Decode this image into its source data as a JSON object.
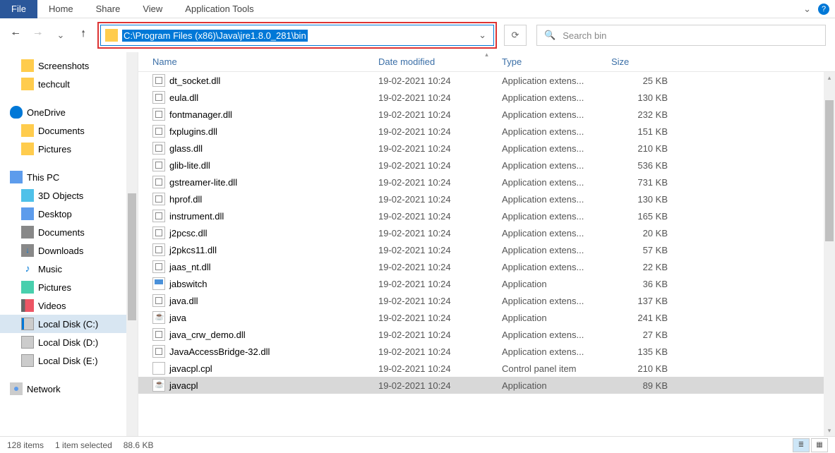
{
  "ribbon": {
    "file": "File",
    "home": "Home",
    "share": "Share",
    "view": "View",
    "apptools": "Application Tools"
  },
  "address": {
    "path": "C:\\Program Files (x86)\\Java\\jre1.8.0_281\\bin"
  },
  "search": {
    "placeholder": "Search bin"
  },
  "columns": {
    "name": "Name",
    "date": "Date modified",
    "type": "Type",
    "size": "Size"
  },
  "nav": {
    "screenshots": "Screenshots",
    "techcult": "techcult",
    "onedrive": "OneDrive",
    "documents": "Documents",
    "pictures": "Pictures",
    "thispc": "This PC",
    "objects3d": "3D Objects",
    "desktop": "Desktop",
    "documents2": "Documents",
    "downloads": "Downloads",
    "music": "Music",
    "pictures2": "Pictures",
    "videos": "Videos",
    "localc": "Local Disk (C:)",
    "locald": "Local Disk (D:)",
    "locale": "Local Disk (E:)",
    "network": "Network"
  },
  "files": [
    {
      "icon": "dll",
      "name": "dt_socket.dll",
      "date": "19-02-2021 10:24",
      "type": "Application extens...",
      "size": "25 KB",
      "sel": false
    },
    {
      "icon": "dll",
      "name": "eula.dll",
      "date": "19-02-2021 10:24",
      "type": "Application extens...",
      "size": "130 KB",
      "sel": false
    },
    {
      "icon": "dll",
      "name": "fontmanager.dll",
      "date": "19-02-2021 10:24",
      "type": "Application extens...",
      "size": "232 KB",
      "sel": false
    },
    {
      "icon": "dll",
      "name": "fxplugins.dll",
      "date": "19-02-2021 10:24",
      "type": "Application extens...",
      "size": "151 KB",
      "sel": false
    },
    {
      "icon": "dll",
      "name": "glass.dll",
      "date": "19-02-2021 10:24",
      "type": "Application extens...",
      "size": "210 KB",
      "sel": false
    },
    {
      "icon": "dll",
      "name": "glib-lite.dll",
      "date": "19-02-2021 10:24",
      "type": "Application extens...",
      "size": "536 KB",
      "sel": false
    },
    {
      "icon": "dll",
      "name": "gstreamer-lite.dll",
      "date": "19-02-2021 10:24",
      "type": "Application extens...",
      "size": "731 KB",
      "sel": false
    },
    {
      "icon": "dll",
      "name": "hprof.dll",
      "date": "19-02-2021 10:24",
      "type": "Application extens...",
      "size": "130 KB",
      "sel": false
    },
    {
      "icon": "dll",
      "name": "instrument.dll",
      "date": "19-02-2021 10:24",
      "type": "Application extens...",
      "size": "165 KB",
      "sel": false
    },
    {
      "icon": "dll",
      "name": "j2pcsc.dll",
      "date": "19-02-2021 10:24",
      "type": "Application extens...",
      "size": "20 KB",
      "sel": false
    },
    {
      "icon": "dll",
      "name": "j2pkcs11.dll",
      "date": "19-02-2021 10:24",
      "type": "Application extens...",
      "size": "57 KB",
      "sel": false
    },
    {
      "icon": "dll",
      "name": "jaas_nt.dll",
      "date": "19-02-2021 10:24",
      "type": "Application extens...",
      "size": "22 KB",
      "sel": false
    },
    {
      "icon": "app",
      "name": "jabswitch",
      "date": "19-02-2021 10:24",
      "type": "Application",
      "size": "36 KB",
      "sel": false
    },
    {
      "icon": "dll",
      "name": "java.dll",
      "date": "19-02-2021 10:24",
      "type": "Application extens...",
      "size": "137 KB",
      "sel": false
    },
    {
      "icon": "java",
      "name": "java",
      "date": "19-02-2021 10:24",
      "type": "Application",
      "size": "241 KB",
      "sel": false
    },
    {
      "icon": "dll",
      "name": "java_crw_demo.dll",
      "date": "19-02-2021 10:24",
      "type": "Application extens...",
      "size": "27 KB",
      "sel": false
    },
    {
      "icon": "dll",
      "name": "JavaAccessBridge-32.dll",
      "date": "19-02-2021 10:24",
      "type": "Application extens...",
      "size": "135 KB",
      "sel": false
    },
    {
      "icon": "cpl",
      "name": "javacpl.cpl",
      "date": "19-02-2021 10:24",
      "type": "Control panel item",
      "size": "210 KB",
      "sel": false
    },
    {
      "icon": "java",
      "name": "javacpl",
      "date": "19-02-2021 10:24",
      "type": "Application",
      "size": "89 KB",
      "sel": true
    }
  ],
  "status": {
    "items": "128 items",
    "selected": "1 item selected",
    "size": "88.6 KB"
  }
}
